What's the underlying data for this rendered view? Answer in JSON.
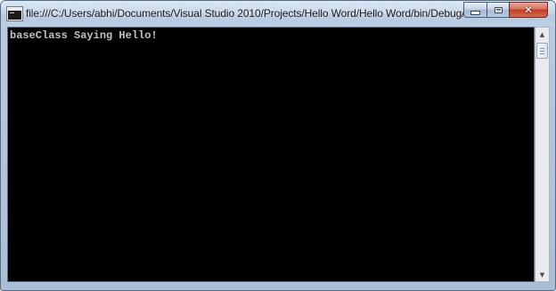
{
  "window": {
    "title": "file:///C:/Users/abhi/Documents/Visual Studio 2010/Projects/Hello Word/Hello Word/bin/Debug/...",
    "icon": "console-app-icon",
    "buttons": {
      "minimize_icon": "minimize-icon",
      "maximize_icon": "maximize-icon",
      "close_icon": "close-icon",
      "close_glyph": "✕"
    }
  },
  "console": {
    "output": "baseClass Saying Hello!",
    "background": "#000000",
    "text_color": "#c0c0c0"
  },
  "scrollbar": {
    "up_arrow": "▲",
    "down_arrow": "▼"
  },
  "colors": {
    "close_button": "#c43c22",
    "titlebar": "#c6d7ea"
  }
}
